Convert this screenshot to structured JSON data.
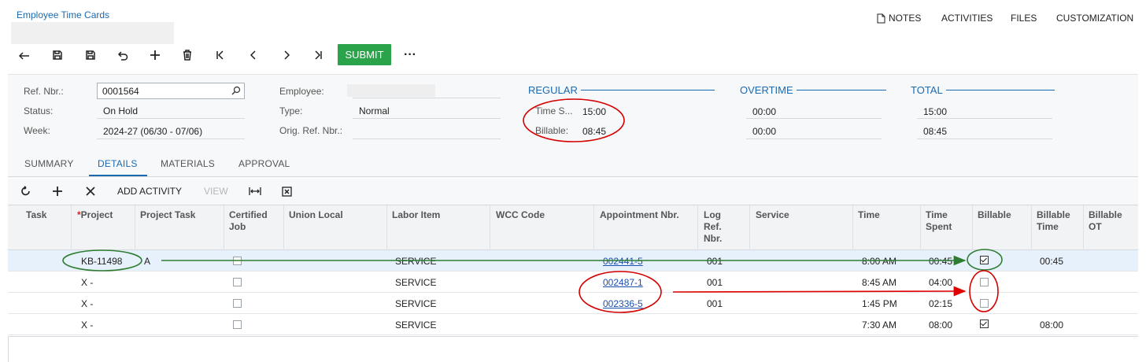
{
  "page": {
    "title": "Employee Time Cards"
  },
  "top_actions": {
    "notes": "NOTES",
    "activities": "ACTIVITIES",
    "files": "FILES",
    "customization": "CUSTOMIZATION"
  },
  "toolbar": {
    "submit": "SUBMIT",
    "more": "···",
    "icons": [
      "back-icon",
      "save-close-icon",
      "save-icon",
      "undo-icon",
      "add-icon",
      "delete-icon",
      "first-icon",
      "prev-icon",
      "next-icon",
      "last-icon"
    ]
  },
  "form": {
    "ref_nbr_label": "Ref. Nbr.:",
    "ref_nbr_value": "0001564",
    "status_label": "Status:",
    "status_value": "On Hold",
    "week_label": "Week:",
    "week_value": "2024-27 (06/30 - 07/06)",
    "employee_label": "Employee:",
    "employee_value": "",
    "type_label": "Type:",
    "type_value": "Normal",
    "orig_ref_label": "Orig. Ref. Nbr.:",
    "orig_ref_value": ""
  },
  "summary": {
    "regular_label": "REGULAR",
    "overtime_label": "OVERTIME",
    "total_label": "TOTAL",
    "time_spent_label": "Time S...",
    "billable_label": "Billable:",
    "regular_time_spent": "15:00",
    "regular_billable": "08:45",
    "overtime_time_spent": "00:00",
    "overtime_billable": "00:00",
    "total_time_spent": "15:00",
    "total_billable": "08:45"
  },
  "tabs": [
    {
      "label": "SUMMARY",
      "active": false
    },
    {
      "label": "DETAILS",
      "active": true
    },
    {
      "label": "MATERIALS",
      "active": false
    },
    {
      "label": "APPROVAL",
      "active": false
    }
  ],
  "grid_toolbar": {
    "add_activity": "ADD ACTIVITY",
    "view": "VIEW"
  },
  "columns": {
    "task": "Task",
    "project_req": "*",
    "project": "Project",
    "project_task": "Project Task",
    "certified_job_1": "Certified",
    "certified_job_2": "Job",
    "union_local": "Union Local",
    "labor_item": "Labor Item",
    "wcc_code": "WCC Code",
    "appointment_nbr": "Appointment Nbr.",
    "log_ref_1": "Log",
    "log_ref_2": "Ref.",
    "log_ref_3": "Nbr.",
    "service": "Service",
    "time": "Time",
    "time_spent_1": "Time",
    "time_spent_2": "Spent",
    "billable": "Billable",
    "billable_time_1": "Billable",
    "billable_time_2": "Time",
    "billable_ot_1": "Billable",
    "billable_ot_2": "OT"
  },
  "rows": [
    {
      "project": "KB-11498",
      "project_task": "A",
      "labor_item": "SERVICE",
      "appointment": "002441-5",
      "log_ref": "001",
      "time": "8:00 AM",
      "time_spent": "00:45",
      "billable": true,
      "billable_time": "00:45"
    },
    {
      "project": "X -",
      "project_task": "",
      "labor_item": "SERVICE",
      "appointment": "002487-1",
      "log_ref": "001",
      "time": "8:45 AM",
      "time_spent": "04:00",
      "billable": false,
      "billable_time": ""
    },
    {
      "project": "X -",
      "project_task": "",
      "labor_item": "SERVICE",
      "appointment": "002336-5",
      "log_ref": "001",
      "time": "1:45 PM",
      "time_spent": "02:15",
      "billable": false,
      "billable_time": ""
    },
    {
      "project": "X -",
      "project_task": "",
      "labor_item": "SERVICE",
      "appointment": "",
      "log_ref": "",
      "time": "7:30 AM",
      "time_spent": "08:00",
      "billable": true,
      "billable_time": "08:00"
    }
  ],
  "annotations": {
    "circle_red_color": "#d40000",
    "circle_green_color": "#2e7d32",
    "arrow_green_color": "#2e7d32",
    "arrow_red_color": "#e00000"
  }
}
